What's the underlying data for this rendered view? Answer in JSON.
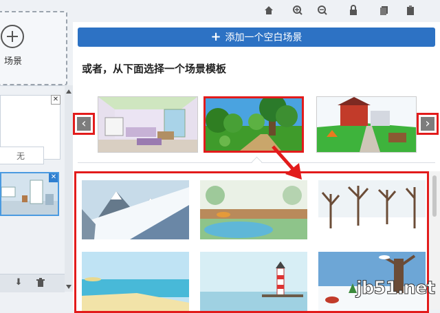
{
  "left_panel": {
    "add_scene_label": "场景",
    "scene_none_label": "无",
    "card_close_glyph": "✕"
  },
  "toolbar_icons": [
    "home-icon",
    "zoom-in-icon",
    "zoom-out-icon",
    "lock-icon",
    "copy-icon",
    "paste-icon"
  ],
  "main": {
    "blank_scene_button": "添加一个空白场景",
    "blank_scene_plus": "+",
    "or_label": "或者，从下面选择一个场景模板",
    "prev_glyph": "‹",
    "next_glyph": "›"
  },
  "carousel": {
    "selected_index": 1,
    "templates": [
      "living-room",
      "forest-path",
      "school-building"
    ]
  },
  "grid": {
    "templates": [
      "snowy-mountains",
      "lake-fence",
      "winter-trees",
      "beach",
      "lighthouse",
      "snow-tree"
    ]
  },
  "watermark": "jb51.net",
  "colors": {
    "accent_blue": "#2d72c4",
    "highlight_red": "#e21b1b"
  }
}
